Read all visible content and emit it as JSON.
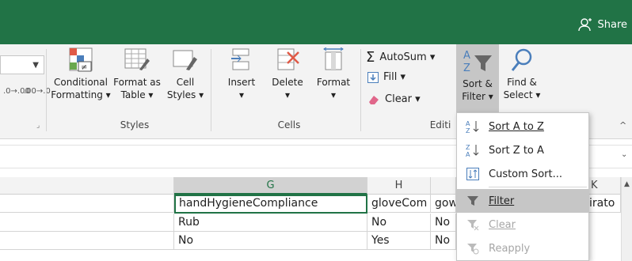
{
  "titlebar": {
    "share_label": "Share"
  },
  "ribbon": {
    "number_format": {
      "decimal_inc": ".0→.00",
      "decimal_dec": ".00→.0"
    },
    "styles": {
      "label": "Styles",
      "conditional": [
        "Conditional",
        "Formatting ▾"
      ],
      "format_table": [
        "Format as",
        "Table ▾"
      ],
      "cell_styles": [
        "Cell",
        "Styles ▾"
      ]
    },
    "cells": {
      "label": "Cells",
      "insert": [
        "Insert",
        "▾"
      ],
      "delete": [
        "Delete",
        "▾"
      ],
      "format": [
        "Format",
        "▾"
      ]
    },
    "editing": {
      "label": "Editi",
      "autosum": "AutoSum ▾",
      "fill": "Fill ▾",
      "clear": "Clear ▾",
      "sort_filter": [
        "Sort &",
        "Filter ▾"
      ],
      "find_select": [
        "Find &",
        "Select ▾"
      ]
    }
  },
  "grid": {
    "columns": [
      "G",
      "H",
      "",
      "K"
    ],
    "rows": [
      [
        "handHygieneCompliance",
        "gloveCom",
        "gow",
        "irato"
      ],
      [
        "Rub",
        "No",
        "No",
        ""
      ],
      [
        "No",
        "Yes",
        "No",
        ""
      ]
    ]
  },
  "sort_menu": {
    "items": [
      {
        "label": "Sort A to Z",
        "icon": "sort-asc-icon",
        "disabled": false,
        "highlighted": false
      },
      {
        "label": "Sort Z to A",
        "icon": "sort-desc-icon",
        "disabled": false,
        "highlighted": false
      },
      {
        "label": "Custom Sort...",
        "icon": "custom-sort-icon",
        "disabled": false,
        "highlighted": false
      },
      {
        "label": "Filter",
        "icon": "filter-icon",
        "disabled": false,
        "highlighted": true
      },
      {
        "label": "Clear",
        "icon": "clear-filter-icon",
        "disabled": true,
        "highlighted": false
      },
      {
        "label": "Reapply",
        "icon": "reapply-icon",
        "disabled": true,
        "highlighted": false
      }
    ]
  },
  "colors": {
    "excel_green": "#217346",
    "ribbon_bg": "#f3f3f3",
    "menu_highlight": "#c6c6c6"
  }
}
